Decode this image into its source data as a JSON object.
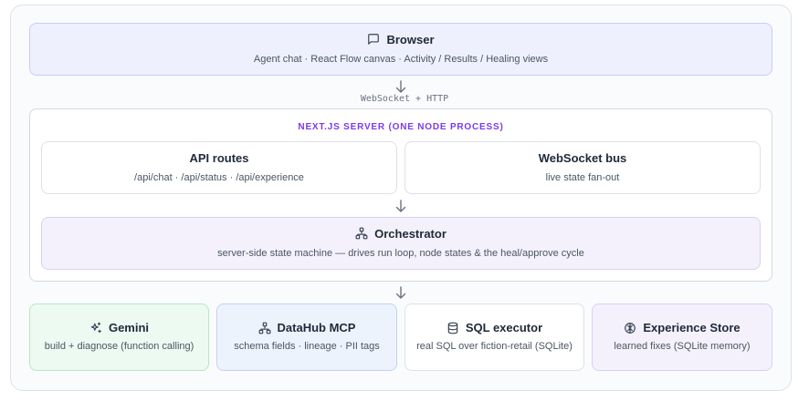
{
  "browser": {
    "title": "Browser",
    "subtitle": "Agent chat · React Flow canvas · Activity / Results / Healing views",
    "icon": "chat-bubble-icon"
  },
  "connection_label": "WebSocket + HTTP",
  "server": {
    "label": "NEXT.JS SERVER (ONE NODE PROCESS)",
    "api_routes": {
      "title": "API routes",
      "subtitle": "/api/chat · /api/status · /api/experience"
    },
    "websocket_bus": {
      "title": "WebSocket bus",
      "subtitle": "live state fan-out"
    },
    "orchestrator": {
      "title": "Orchestrator",
      "subtitle": "server-side state machine — drives run loop, node states & the heal/approve cycle",
      "icon": "hierarchy-icon"
    }
  },
  "services": [
    {
      "title": "Gemini",
      "subtitle": "build + diagnose (function calling)",
      "icon": "sparkles-icon"
    },
    {
      "title": "DataHub MCP",
      "subtitle": "schema fields · lineage · PII tags",
      "icon": "hierarchy-icon"
    },
    {
      "title": "SQL executor",
      "subtitle": "real SQL over fiction-retail (SQLite)",
      "icon": "database-icon"
    },
    {
      "title": "Experience Store",
      "subtitle": "learned fixes (SQLite memory)",
      "icon": "brain-icon"
    }
  ],
  "colors": {
    "browser_bg": "#eef0fd",
    "server_label": "#7c3aed",
    "orchestrator_bg": "#f4f1fd",
    "gemini_bg": "#ecfaf2",
    "datahub_bg": "#edf3fd",
    "experience_bg": "#f4f1fd"
  }
}
